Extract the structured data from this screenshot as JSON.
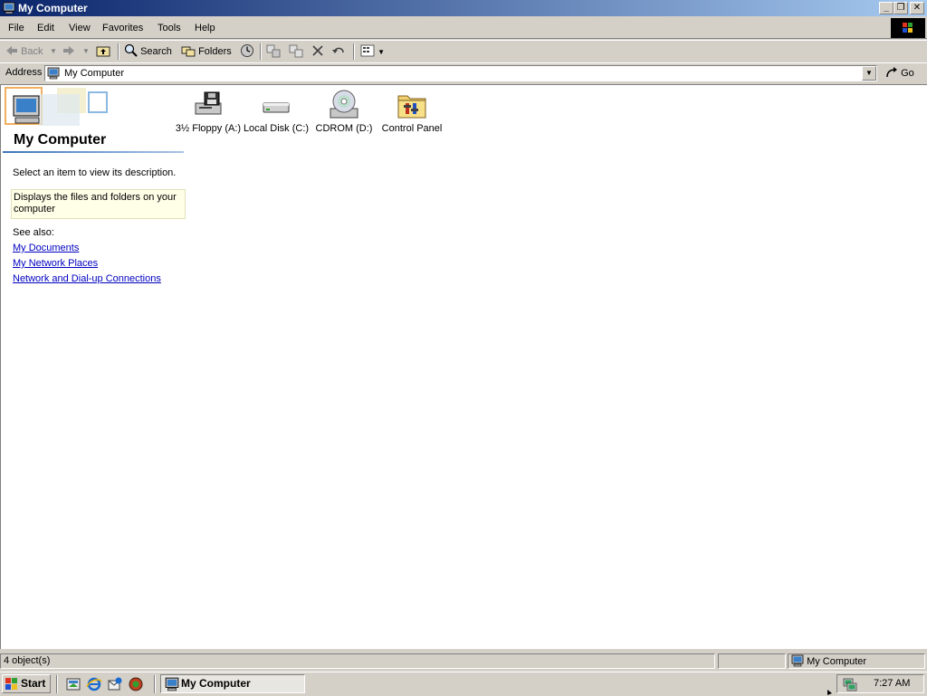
{
  "window": {
    "title": "My Computer"
  },
  "menu": [
    "File",
    "Edit",
    "View",
    "Favorites",
    "Tools",
    "Help"
  ],
  "toolbar": {
    "back": "Back",
    "search": "Search",
    "folders": "Folders"
  },
  "address": {
    "label": "Address",
    "value": "My Computer",
    "go": "Go"
  },
  "sidebar": {
    "title": "My Computer",
    "hint": "Select an item to view its description.",
    "description": "Displays the files and folders on your computer",
    "see_also": "See also:",
    "links": [
      "My Documents",
      "My Network Places",
      "Network and Dial-up Connections"
    ]
  },
  "items": [
    {
      "label": "3½ Floppy (A:)",
      "icon": "floppy-drive-icon"
    },
    {
      "label": "Local Disk (C:)",
      "icon": "hard-disk-icon"
    },
    {
      "label": "CDROM (D:)",
      "icon": "cdrom-drive-icon"
    },
    {
      "label": "Control Panel",
      "icon": "control-panel-icon"
    }
  ],
  "status": {
    "objects": "4 object(s)",
    "zone": "My Computer"
  },
  "taskbar": {
    "start": "Start",
    "task": "My Computer",
    "clock": "7:27 AM"
  }
}
